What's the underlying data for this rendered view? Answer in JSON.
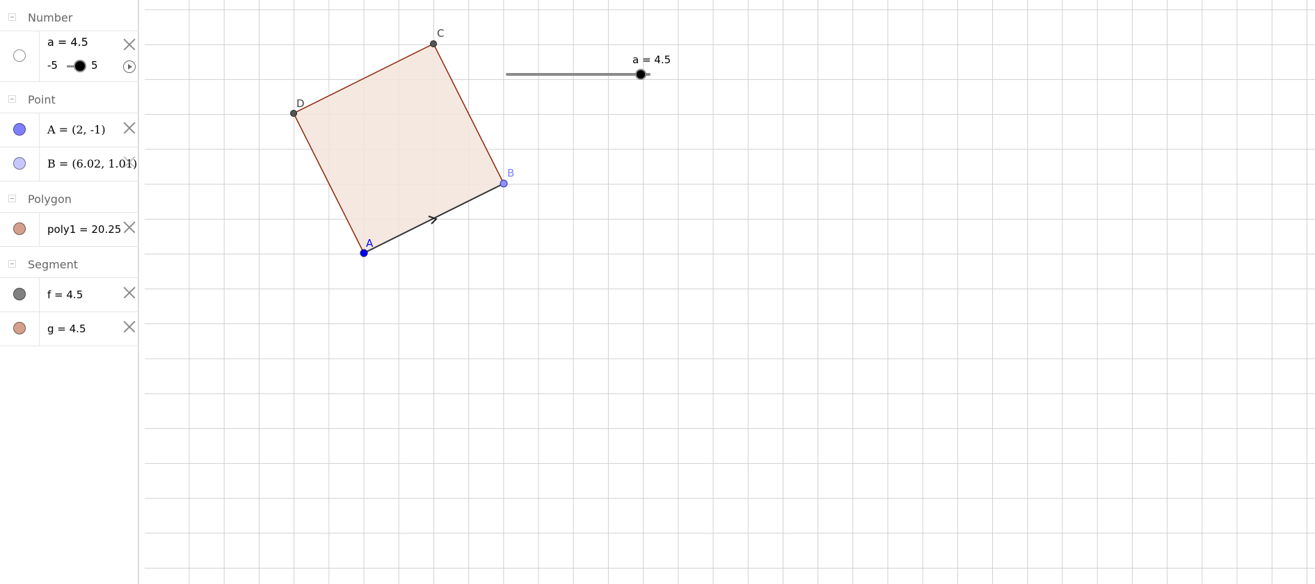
{
  "algebra": {
    "groups": [
      {
        "label": "Number"
      },
      {
        "label": "Point"
      },
      {
        "label": "Polygon"
      },
      {
        "label": "Segment"
      }
    ],
    "items": {
      "a": {
        "text": "a = 4.5",
        "slider_min": "-5",
        "slider_max": "5",
        "color": "#808080"
      },
      "A": {
        "text": "A = (2, -1)",
        "color": "#8080ff"
      },
      "B": {
        "text": "B = (6.02, 1.01)",
        "color": "#c8c8ff"
      },
      "poly1": {
        "text": "poly1 = 20.25",
        "color": "#d4a08c"
      },
      "f": {
        "text": "f = 4.5",
        "color": "#808080"
      },
      "g": {
        "text": "g = 4.5",
        "color": "#d4a08c"
      }
    }
  },
  "graphics": {
    "slider_label": "a = 4.5",
    "slider_value_fraction": 0.95,
    "points": {
      "A": {
        "label": "A",
        "color": "#0000ff"
      },
      "B": {
        "label": "B",
        "color": "#8080ff"
      },
      "C": {
        "label": "C",
        "color": "#444444"
      },
      "D": {
        "label": "D",
        "color": "#444444"
      }
    },
    "polygon_fill": "#f3e4dc",
    "polygon_edge": "#8b2500",
    "grid_color": "#d0d0d0"
  }
}
